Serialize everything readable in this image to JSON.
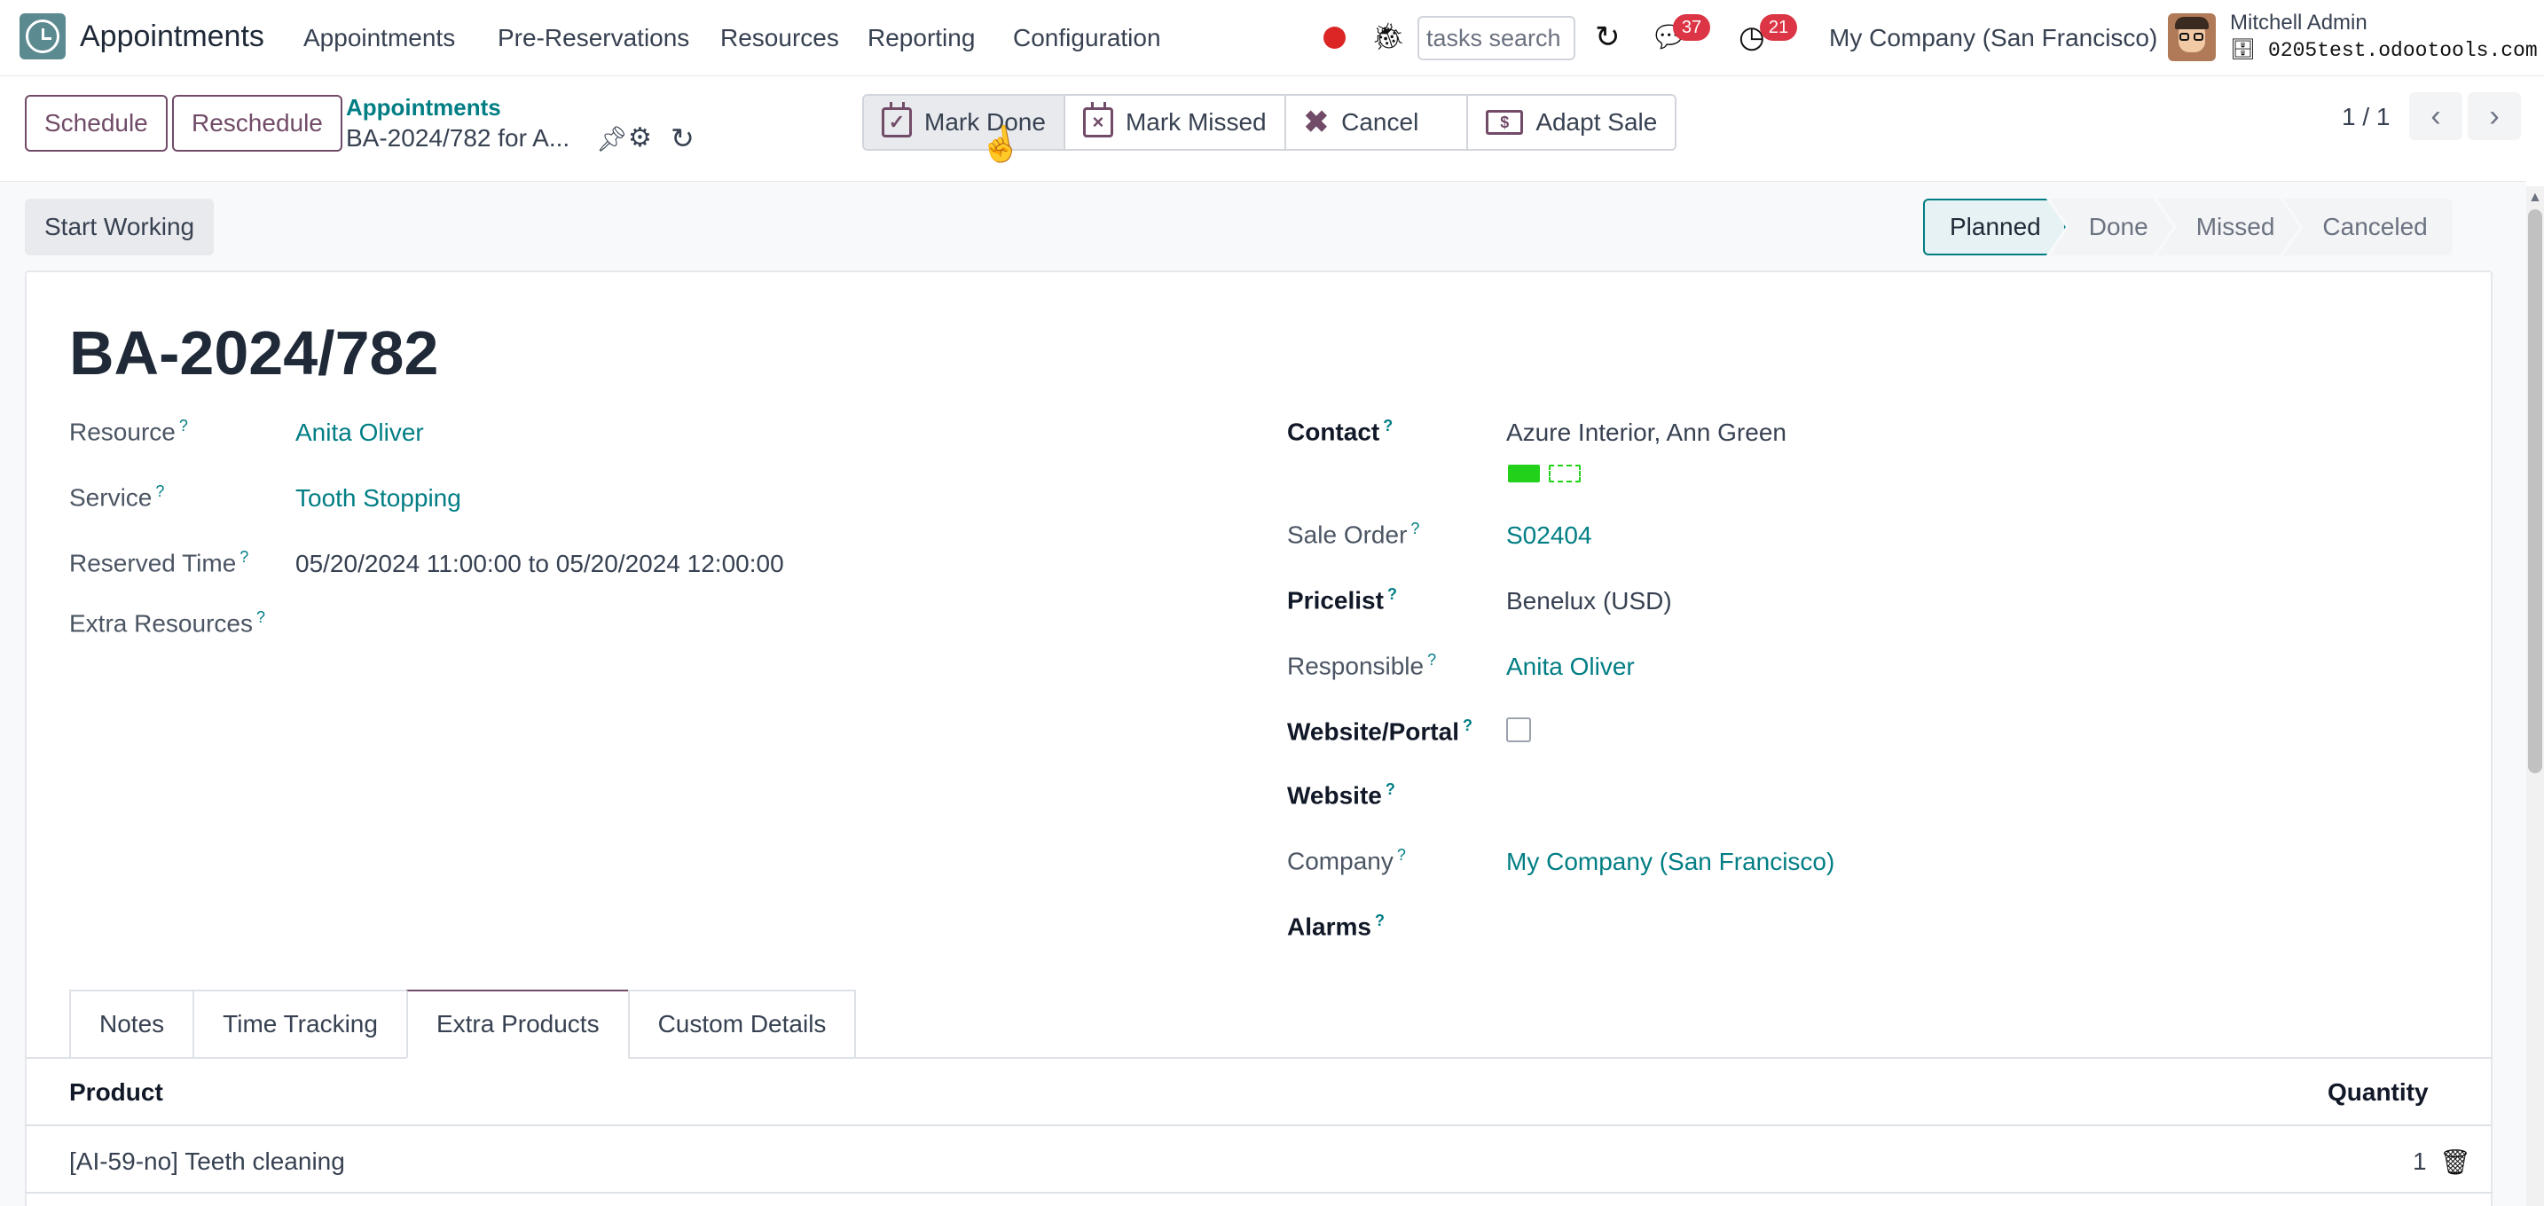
{
  "navbar": {
    "app_name": "Appointments",
    "menu": [
      "Appointments",
      "Pre-Reservations",
      "Resources",
      "Reporting",
      "Configuration"
    ],
    "search_placeholder": "tasks search",
    "messages_count": "37",
    "activities_count": "21",
    "company": "My Company (San Francisco)",
    "user_name": "Mitchell Admin",
    "database": "0205test.odootools.com"
  },
  "control": {
    "schedule_label": "Schedule",
    "reschedule_label": "Reschedule",
    "breadcrumb_parent": "Appointments",
    "breadcrumb_current": "BA-2024/782 for A...",
    "actions": {
      "mark_done": "Mark Done",
      "mark_missed": "Mark Missed",
      "cancel": "Cancel",
      "adapt_sale": "Adapt Sale"
    },
    "pager": "1 / 1"
  },
  "status": {
    "start_working": "Start Working",
    "stages": [
      "Planned",
      "Done",
      "Missed",
      "Canceled"
    ],
    "current_stage": "Planned"
  },
  "record": {
    "title": "BA-2024/782",
    "left_fields": {
      "resource_label": "Resource",
      "resource_value": "Anita Oliver",
      "service_label": "Service",
      "service_value": "Tooth Stopping",
      "reserved_time_label": "Reserved Time",
      "reserved_time_value": "05/20/2024 11:00:00 to 05/20/2024 12:00:00",
      "extra_resources_label": "Extra Resources"
    },
    "right_fields": {
      "contact_label": "Contact",
      "contact_value": "Azure Interior, Ann Green",
      "sale_order_label": "Sale Order",
      "sale_order_value": "S02404",
      "pricelist_label": "Pricelist",
      "pricelist_value": "Benelux (USD)",
      "responsible_label": "Responsible",
      "responsible_value": "Anita Oliver",
      "website_portal_label": "Website/Portal",
      "website_label": "Website",
      "company_label": "Company",
      "company_value": "My Company (San Francisco)",
      "alarms_label": "Alarms"
    },
    "help_mark": "?"
  },
  "tabs": [
    "Notes",
    "Time Tracking",
    "Extra Products",
    "Custom Details"
  ],
  "active_tab": "Extra Products",
  "products_table": {
    "columns": [
      "Product",
      "Quantity"
    ],
    "rows": [
      {
        "product": "[AI-59-no] Teeth cleaning",
        "quantity": "1"
      }
    ]
  },
  "colors": {
    "brand": "#714b67",
    "link": "#017e84",
    "badge": "#dc3545",
    "tag": "#22d21a"
  }
}
